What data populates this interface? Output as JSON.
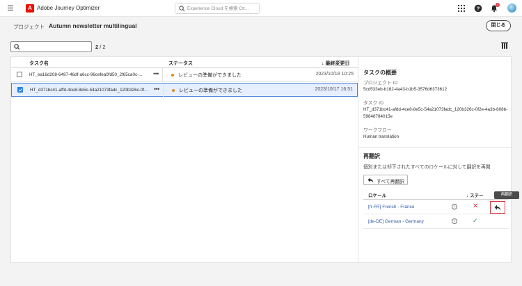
{
  "topbar": {
    "menu_icon": "hamburger-icon",
    "app_title": "Adobe Journey Optimizer",
    "search_placeholder": "Experience Cloud を検索 Ctr...",
    "notification_count": "4"
  },
  "header": {
    "prefix": "プロジェクト",
    "project_name": "Autumn newsletter multilingual",
    "close_label": "閉じる"
  },
  "toolbar": {
    "count_shown": "2",
    "count_total": "/ 2"
  },
  "table": {
    "columns": {
      "name": "タスク名",
      "status": "ステータス",
      "modified": "最終変更日"
    },
    "rows": [
      {
        "name": "HT_ea16d208-6497-46df-a6cc-96cefea0fd50_2f65ca0c-...",
        "status": "レビューの準備ができました",
        "date": "2023/10/18 10:25",
        "selected": false
      },
      {
        "name": "HT_d371bc41-affd-4ce8-8e5c-54a21073fadc_120b326c-0f...",
        "status": "レビューの準備ができました",
        "date": "2023/10/17 16:51",
        "selected": true
      }
    ]
  },
  "details": {
    "title": "タスクの概要",
    "project_id_label": "プロジェクト ID",
    "project_id": "5cd533eb-b182-4a43-b1b5-3576d6373612",
    "task_id_label": "タスク ID",
    "task_id_line1": "HT_d371bc41-afdd-4ce8-8e5c-54a21073fadc_120b326c-0f2e-4a3b-808b-",
    "task_id_line2": "59848784015e",
    "workflow_label": "ワークフロー",
    "workflow": "Human translation",
    "retranslate_title": "再翻訳",
    "retranslate_desc": "個別または却下されたすべてのロケールに対して翻訳を再開",
    "retranslate_all_label": "すべて再翻訳",
    "locale_col": "ロケール",
    "status_col": "ステー",
    "tooltip": "再翻訳",
    "locales": [
      {
        "name": "[fr-FR] French - France",
        "status": "rejected"
      },
      {
        "name": "[de-DE] German - Germany",
        "status": "approved"
      }
    ]
  }
}
